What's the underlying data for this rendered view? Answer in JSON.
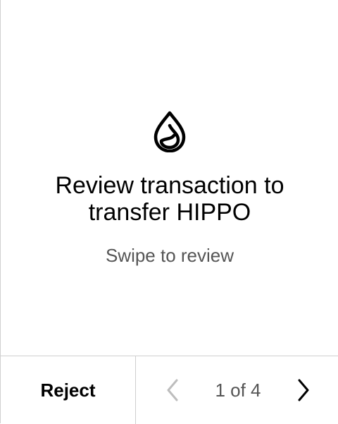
{
  "main": {
    "icon": "water-drop-icon",
    "title": "Review transaction to transfer HIPPO",
    "subtitle": "Swipe to review"
  },
  "footer": {
    "reject_label": "Reject",
    "page_indicator": "1 of 4",
    "prev_icon": "chevron-left-icon",
    "next_icon": "chevron-right-icon"
  },
  "colors": {
    "background": "#ffffff",
    "text": "#000000",
    "muted_text": "#555555",
    "disabled_icon": "#bdbdbd",
    "divider": "#cfcfcf"
  }
}
